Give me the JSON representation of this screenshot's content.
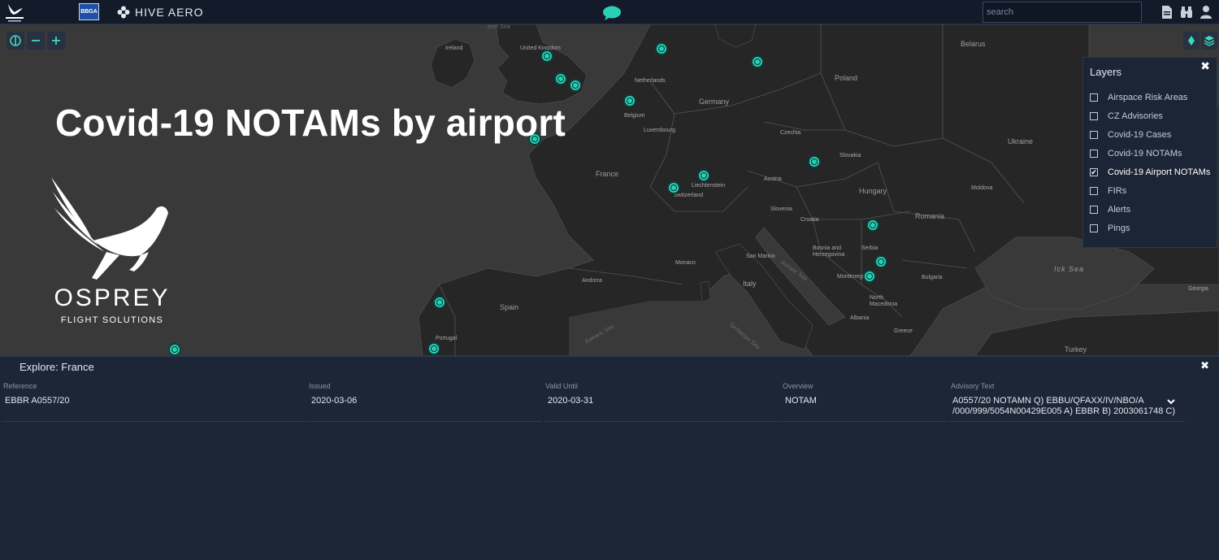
{
  "topbar": {
    "bbga_label": "BBGA",
    "hive_label": "HIVE AERO",
    "search_placeholder": "search"
  },
  "map": {
    "countries": [
      {
        "id": "uk",
        "label": "United Kingdom"
      },
      {
        "id": "ireland",
        "label": "Ireland"
      },
      {
        "id": "netherlands",
        "label": "Netherlands"
      },
      {
        "id": "belgium",
        "label": "Belgium"
      },
      {
        "id": "luxembourg",
        "label": "Luxembourg"
      },
      {
        "id": "germany",
        "label": "Germany"
      },
      {
        "id": "poland",
        "label": "Poland"
      },
      {
        "id": "belarus",
        "label": "Belarus"
      },
      {
        "id": "ukraine",
        "label": "Ukraine"
      },
      {
        "id": "czechia",
        "label": "Czechia"
      },
      {
        "id": "slovakia",
        "label": "Slovakia"
      },
      {
        "id": "austria",
        "label": "Austria"
      },
      {
        "id": "hungary",
        "label": "Hungary"
      },
      {
        "id": "moldova",
        "label": "Moldova"
      },
      {
        "id": "romania",
        "label": "Romania"
      },
      {
        "id": "france",
        "label": "France"
      },
      {
        "id": "switzerland",
        "label": "Switzerland"
      },
      {
        "id": "liechtenstein",
        "label": "Liechtenstein"
      },
      {
        "id": "slovenia",
        "label": "Slovenia"
      },
      {
        "id": "croatia",
        "label": "Croatia"
      },
      {
        "id": "bosnia",
        "label": "Bosnia and Herzegovina"
      },
      {
        "id": "serbia",
        "label": "Serbia"
      },
      {
        "id": "montenegro",
        "label": "Montenegro"
      },
      {
        "id": "north_macedonia",
        "label": "North Macedonia"
      },
      {
        "id": "bulgaria",
        "label": "Bulgaria"
      },
      {
        "id": "albania",
        "label": "Albania"
      },
      {
        "id": "greece",
        "label": "Greece"
      },
      {
        "id": "turkey",
        "label": "Turkey"
      },
      {
        "id": "georgia",
        "label": "Georgia"
      },
      {
        "id": "italy",
        "label": "Italy"
      },
      {
        "id": "san_marino",
        "label": "San Marino"
      },
      {
        "id": "monaco",
        "label": "Monaco"
      },
      {
        "id": "andorra",
        "label": "Andorra"
      },
      {
        "id": "spain",
        "label": "Spain"
      },
      {
        "id": "portugal",
        "label": "Portugal"
      }
    ],
    "seas": [
      {
        "id": "irish_sea",
        "label": "Irish Sea"
      },
      {
        "id": "black_sea",
        "label": "Ick Sea"
      },
      {
        "id": "adriatic_sea",
        "label": "Adriatic Sea"
      },
      {
        "id": "tyrrhenian_sea",
        "label": "Tyrrhenian Sea"
      },
      {
        "id": "balearic_sea",
        "label": "Balearic Sea"
      }
    ]
  },
  "overlay": {
    "title": "Covid-19 NOTAMs by airport",
    "logo_name": "OSPREY",
    "logo_sub": "FLIGHT SOLUTIONS"
  },
  "layers": {
    "title": "Layers",
    "items": [
      {
        "label": "Airspace Risk Areas",
        "checked": false
      },
      {
        "label": "CZ Advisories",
        "checked": false
      },
      {
        "label": "Covid-19 Cases",
        "checked": false
      },
      {
        "label": "Covid-19 NOTAMs",
        "checked": false
      },
      {
        "label": "Covid-19 Airport NOTAMs",
        "checked": true
      },
      {
        "label": "FIRs",
        "checked": false
      },
      {
        "label": "Alerts",
        "checked": false
      },
      {
        "label": "Pings",
        "checked": false
      }
    ]
  },
  "explore": {
    "title": "Explore: France",
    "columns": [
      "Reference",
      "Issued",
      "Valid Until",
      "Overview",
      "Advisory Text"
    ],
    "rows": [
      {
        "reference": "EBBR A0557/20",
        "issued": "2020-03-06",
        "valid_until": "2020-03-31",
        "overview": "NOTAM",
        "advisory_line1": "A0557/20 NOTAMN Q) EBBU/QFAXX/IV/NBO/A",
        "advisory_line2": "/000/999/5054N00429E005 A) EBBR B) 2003061748 C)"
      }
    ]
  },
  "colors": {
    "accent": "#2ad0b5",
    "panel": "#1c2536",
    "land": "#2a2a2a",
    "sea": "#393939"
  }
}
